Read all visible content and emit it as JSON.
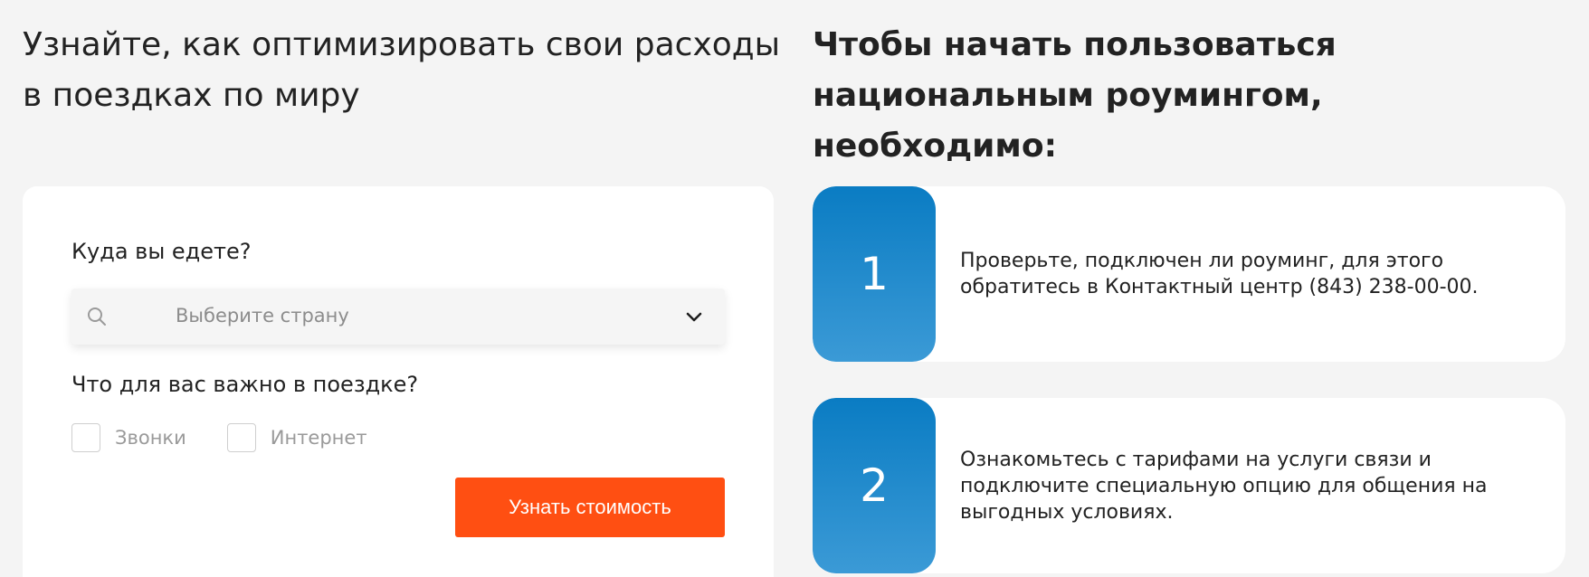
{
  "left": {
    "title": "Узнайте, как оптимизировать свои расходы в поездках по миру",
    "form": {
      "destination_label": "Куда вы едете?",
      "country_placeholder": "Выберите страну",
      "importance_label": "Что для вас важно в поездке?",
      "options": [
        {
          "label": "Звонки",
          "checked": false
        },
        {
          "label": "Интернет",
          "checked": false
        }
      ],
      "submit_label": "Узнать стоимость"
    }
  },
  "right": {
    "title": "Чтобы начать пользоваться национальным роумингом, необходимо:",
    "steps": [
      {
        "number": "1",
        "text": "Проверьте, подключен ли роуминг, для этого обратитесь в Контактный центр (843) 238-00-00."
      },
      {
        "number": "2",
        "text": "Ознакомьтесь с тарифами на услуги связи и подключите специальную опцию для общения на выгодных условиях."
      }
    ]
  },
  "colors": {
    "background": "#f4f4f4",
    "card": "#ffffff",
    "accent_button": "#ff4f12",
    "step_gradient_top": "#0a7cc3",
    "step_gradient_bottom": "#3b9ad6"
  },
  "icons": {
    "search": "search-icon",
    "dropdown": "chevron-down-icon"
  }
}
